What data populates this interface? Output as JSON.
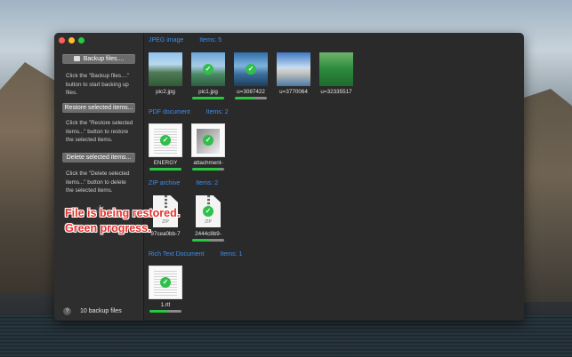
{
  "sidebar": {
    "backup_button": "Backup files....",
    "backup_help": "Click the \"Backup files....\" button to start backing up files.",
    "restore_button": "Restore selected items...",
    "restore_help": "Click the \"Restore selected items...\" button to restore the selected items.",
    "delete_button": "Delete selected items...",
    "delete_help": "Click the \"Delete selected items...\" button to delete the selected items.",
    "help_label": "?",
    "footer_count": "10 backup files"
  },
  "annotation": {
    "line1": "File is being restored.",
    "line2": "Green progress."
  },
  "categories": [
    {
      "name": "JPEG image",
      "count_label": "Items: 5",
      "files": [
        {
          "name": "pic2.jpg",
          "icon": "photo-thumbnail",
          "checked": false,
          "progress": 0
        },
        {
          "name": "pic1.jpg",
          "icon": "photo-thumbnail",
          "checked": true,
          "progress": 1.0
        },
        {
          "name": "u=3087422",
          "icon": "photo-thumbnail",
          "checked": true,
          "progress": 0.6
        },
        {
          "name": "u=3770064",
          "icon": "photo-thumbnail",
          "checked": false,
          "progress": 0
        },
        {
          "name": "u=32335517",
          "icon": "photo-thumbnail",
          "checked": false,
          "progress": 0
        }
      ]
    },
    {
      "name": "PDF document",
      "count_label": "Items: 2",
      "files": [
        {
          "name": "ENERGY",
          "icon": "pdf-thumbnail",
          "checked": true,
          "progress": 1.0
        },
        {
          "name": "attachment-",
          "icon": "pdf-thumbnail",
          "checked": true,
          "progress": 0.85
        }
      ]
    },
    {
      "name": "ZIP archive",
      "count_label": "Items: 2",
      "files": [
        {
          "name": "97cea0bb-7",
          "icon": "zip-icon",
          "checked": false,
          "progress": 0
        },
        {
          "name": "2444c8b9-",
          "icon": "zip-icon",
          "checked": true,
          "progress": 0.55
        }
      ]
    },
    {
      "name": "Rich Text Document",
      "count_label": "Items: 1",
      "files": [
        {
          "name": "1.rtf",
          "icon": "rtf-thumbnail",
          "checked": true,
          "progress": 0.55
        }
      ]
    }
  ],
  "zip_badge": "ZIP",
  "colors": {
    "accent": "#3d8ef0",
    "progress": "#28c840",
    "annotation": "#e6322b"
  }
}
